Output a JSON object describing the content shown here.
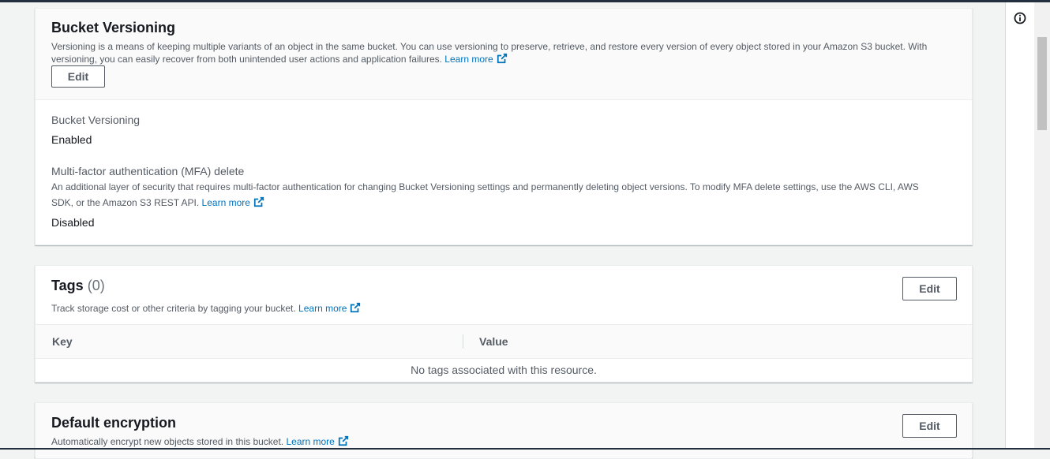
{
  "versioning": {
    "title": "Bucket Versioning",
    "description": "Versioning is a means of keeping multiple variants of an object in the same bucket. You can use versioning to preserve, retrieve, and restore every version of every object stored in your Amazon S3 bucket. With versioning, you can easily recover from both unintended user actions and application failures.",
    "learn_more": "Learn more",
    "edit_label": "Edit",
    "status_label": "Bucket Versioning",
    "status_value": "Enabled",
    "mfa_label": "Multi-factor authentication (MFA) delete",
    "mfa_description": "An additional layer of security that requires multi-factor authentication for changing Bucket Versioning settings and permanently deleting object versions. To modify MFA delete settings, use the AWS CLI, AWS SDK, or the Amazon S3 REST API.",
    "mfa_learn_more": "Learn more",
    "mfa_value": "Disabled"
  },
  "tags": {
    "title": "Tags",
    "count": "(0)",
    "description": "Track storage cost or other criteria by tagging your bucket.",
    "learn_more": "Learn more",
    "edit_label": "Edit",
    "columns": [
      "Key",
      "Value"
    ],
    "empty_message": "No tags associated with this resource."
  },
  "encryption": {
    "title": "Default encryption",
    "description": "Automatically encrypt new objects stored in this bucket.",
    "learn_more": "Learn more",
    "edit_label": "Edit"
  },
  "icons": {
    "info": "info-icon",
    "external_link": "external-link-icon"
  },
  "colors": {
    "link": "#0073bb",
    "page_bg": "#f2f3f3",
    "header_bar": "#232f3e"
  }
}
